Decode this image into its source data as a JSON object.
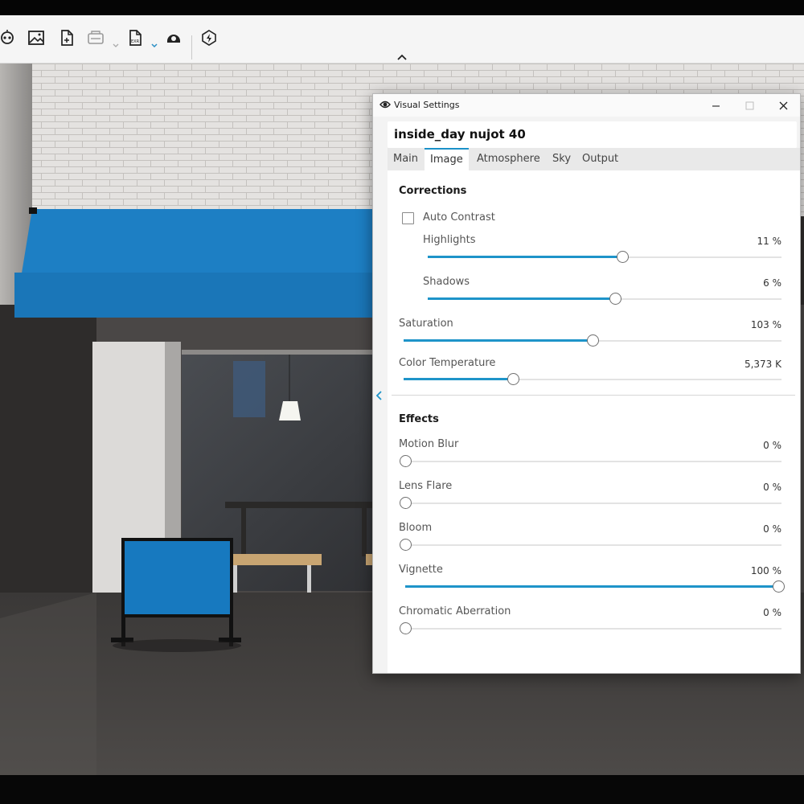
{
  "toolbar": {
    "icons": [
      {
        "name": "batch-render-icon"
      },
      {
        "name": "image-icon"
      },
      {
        "name": "export-file-icon"
      },
      {
        "name": "render-queue-icon"
      },
      {
        "name": "export-exr-icon"
      },
      {
        "name": "panorama-icon"
      },
      {
        "name": "livesync-icon"
      }
    ]
  },
  "dialog": {
    "title": "Visual Settings",
    "preset_name": "inside_day nujot 40",
    "tabs": [
      {
        "label": "Main",
        "active": false
      },
      {
        "label": "Image",
        "active": true
      },
      {
        "label": "Atmosphere",
        "active": false
      },
      {
        "label": "Sky",
        "active": false
      },
      {
        "label": "Output",
        "active": false
      }
    ],
    "accent_color": "#1e94c9",
    "corrections": {
      "title": "Corrections",
      "auto_contrast": {
        "label": "Auto Contrast",
        "checked": false
      },
      "highlights": {
        "label": "Highlights",
        "value": "11 %",
        "level": 0.55
      },
      "shadows": {
        "label": "Shadows",
        "value": "6 %",
        "level": 0.53
      },
      "saturation": {
        "label": "Saturation",
        "value": "103 %",
        "level": 0.5
      },
      "color_temperature": {
        "label": "Color Temperature",
        "value": "5,373 K",
        "level": 0.29
      }
    },
    "effects": {
      "title": "Effects",
      "motion_blur": {
        "label": "Motion Blur",
        "value": "0 %",
        "level": 0
      },
      "lens_flare": {
        "label": "Lens Flare",
        "value": "0 %",
        "level": 0
      },
      "bloom": {
        "label": "Bloom",
        "value": "0 %",
        "level": 0
      },
      "vignette": {
        "label": "Vignette",
        "value": "100 %",
        "level": 1
      },
      "chromatic_aberration": {
        "label": "Chromatic Aberration",
        "value": "0 %",
        "level": 0
      }
    }
  }
}
